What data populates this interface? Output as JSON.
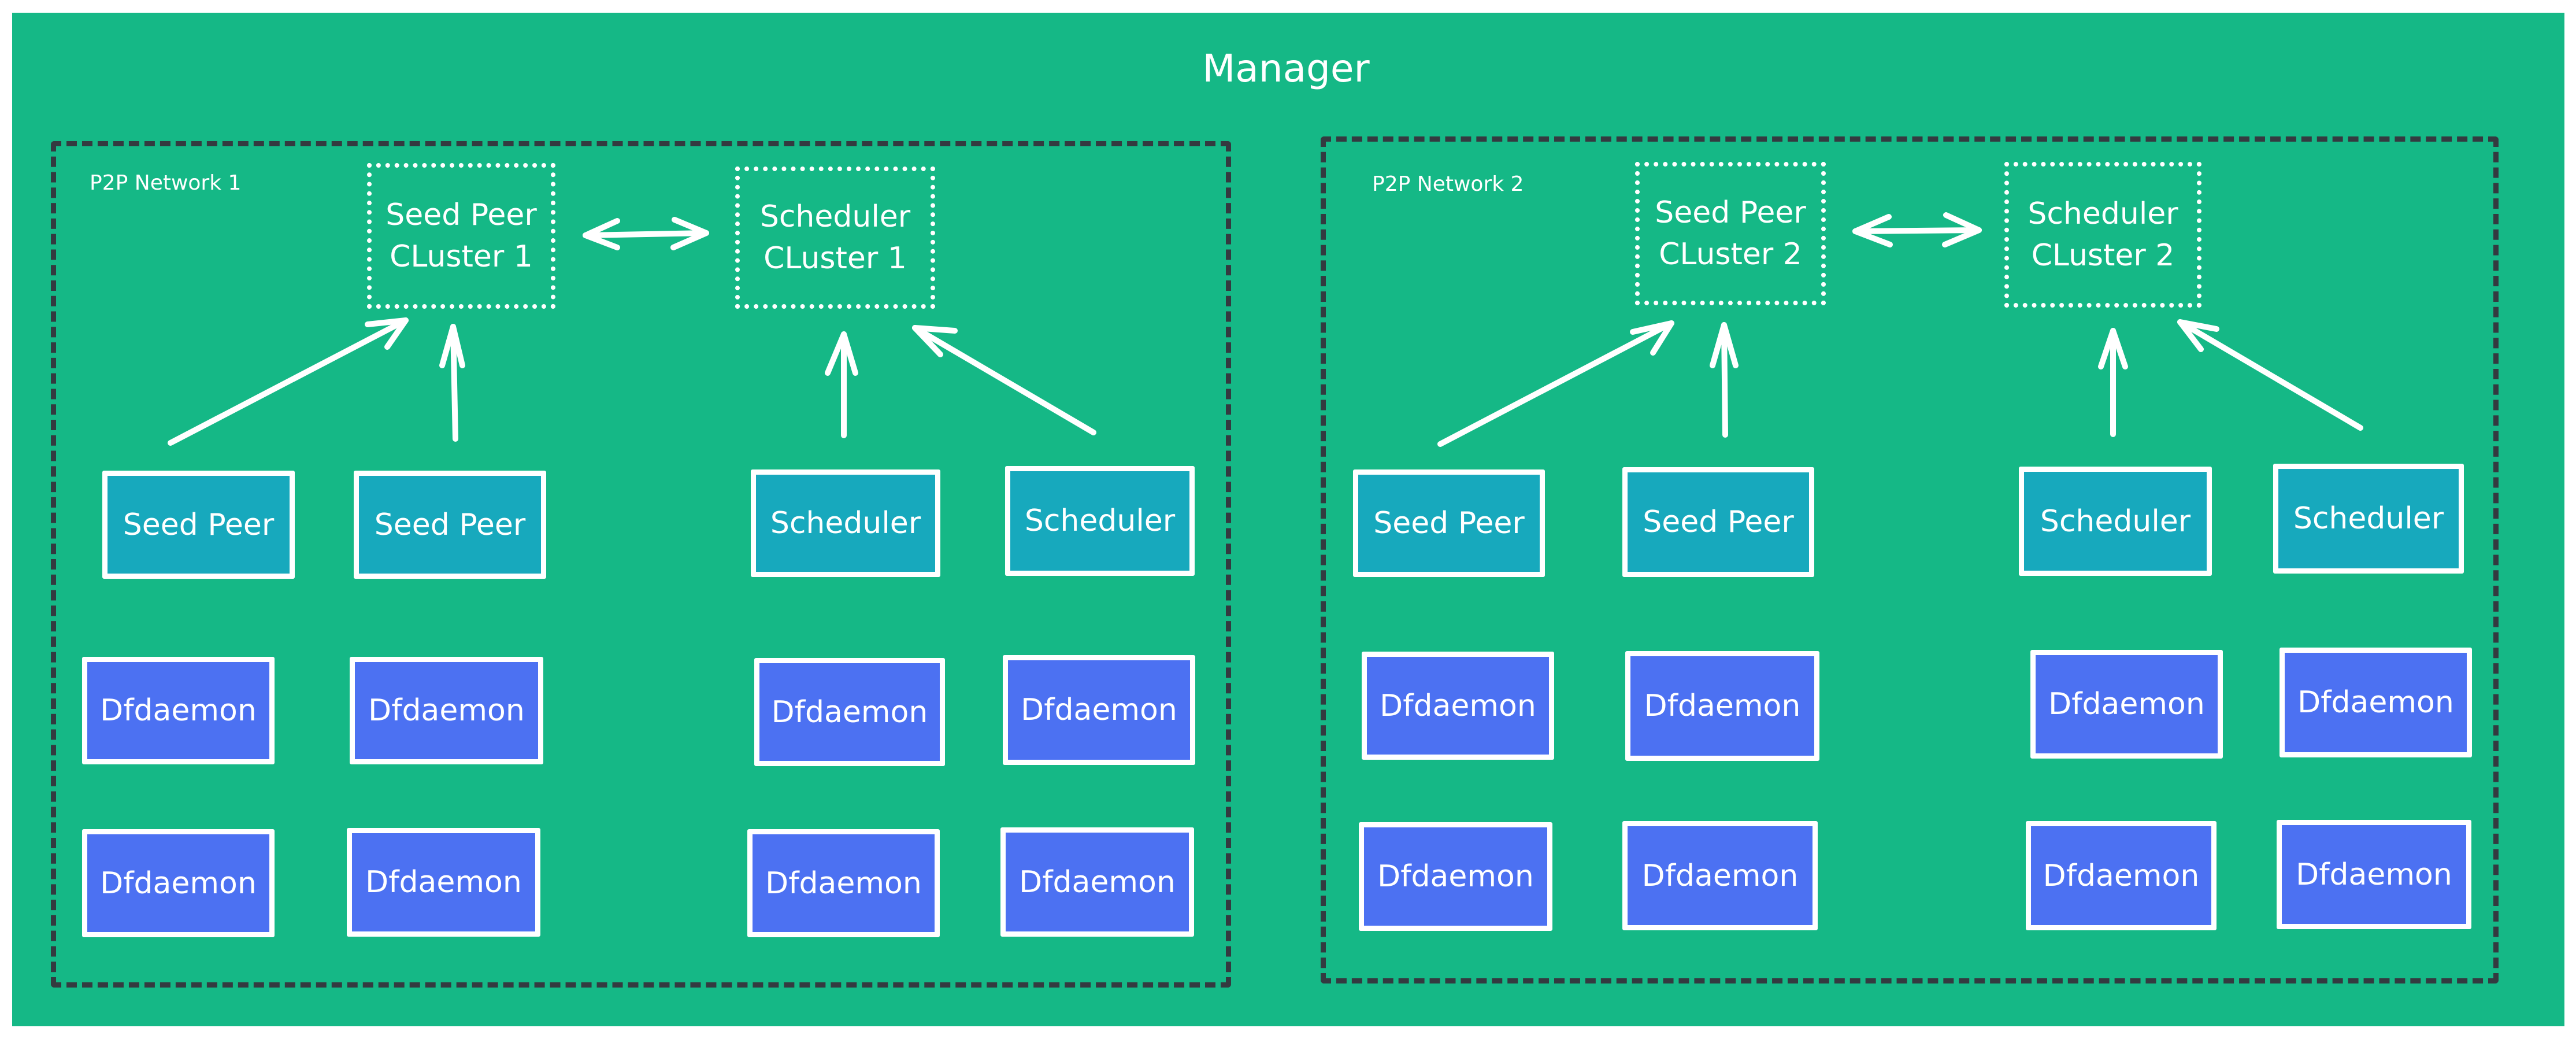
{
  "manager": {
    "title": "Manager",
    "colors": {
      "background": "#15b886",
      "border_dashed": "#343a40",
      "seed_peer_node": "#17a9bd",
      "scheduler_node": "#17a9bd",
      "dfdaemon_node": "#4c71f2",
      "stroke": "#ffffff"
    }
  },
  "networks": [
    {
      "label": "P2P Network 1",
      "seed_peer_cluster": {
        "line1": "Seed Peer",
        "line2": "CLuster 1"
      },
      "scheduler_cluster": {
        "line1": "Scheduler",
        "line2": "CLuster 1"
      },
      "seed_peers": [
        "Seed Peer",
        "Seed Peer"
      ],
      "schedulers": [
        "Scheduler",
        "Scheduler"
      ],
      "dfdaemons": [
        "Dfdaemon",
        "Dfdaemon",
        "Dfdaemon",
        "Dfdaemon",
        "Dfdaemon",
        "Dfdaemon",
        "Dfdaemon",
        "Dfdaemon"
      ]
    },
    {
      "label": "P2P Network 2",
      "seed_peer_cluster": {
        "line1": "Seed Peer",
        "line2": "CLuster 2"
      },
      "scheduler_cluster": {
        "line1": "Scheduler",
        "line2": "CLuster 2"
      },
      "seed_peers": [
        "Seed Peer",
        "Seed Peer"
      ],
      "schedulers": [
        "Scheduler",
        "Scheduler"
      ],
      "dfdaemons": [
        "Dfdaemon",
        "Dfdaemon",
        "Dfdaemon",
        "Dfdaemon",
        "Dfdaemon",
        "Dfdaemon",
        "Dfdaemon",
        "Dfdaemon"
      ]
    }
  ],
  "edges": [
    {
      "from": "Seed Peer Cluster 1",
      "to": "Scheduler Cluster 1",
      "type": "bidirectional"
    },
    {
      "from": "Seed Peer (net1 #1)",
      "to": "Seed Peer Cluster 1",
      "type": "directed"
    },
    {
      "from": "Seed Peer (net1 #2)",
      "to": "Seed Peer Cluster 1",
      "type": "directed"
    },
    {
      "from": "Scheduler (net1 #1)",
      "to": "Scheduler Cluster 1",
      "type": "directed"
    },
    {
      "from": "Scheduler (net1 #2)",
      "to": "Scheduler Cluster 1",
      "type": "directed"
    },
    {
      "from": "Seed Peer Cluster 2",
      "to": "Scheduler Cluster 2",
      "type": "bidirectional"
    },
    {
      "from": "Seed Peer (net2 #1)",
      "to": "Seed Peer Cluster 2",
      "type": "directed"
    },
    {
      "from": "Seed Peer (net2 #2)",
      "to": "Seed Peer Cluster 2",
      "type": "directed"
    },
    {
      "from": "Scheduler (net2 #1)",
      "to": "Scheduler Cluster 2",
      "type": "directed"
    },
    {
      "from": "Scheduler (net2 #2)",
      "to": "Scheduler Cluster 2",
      "type": "directed"
    }
  ]
}
